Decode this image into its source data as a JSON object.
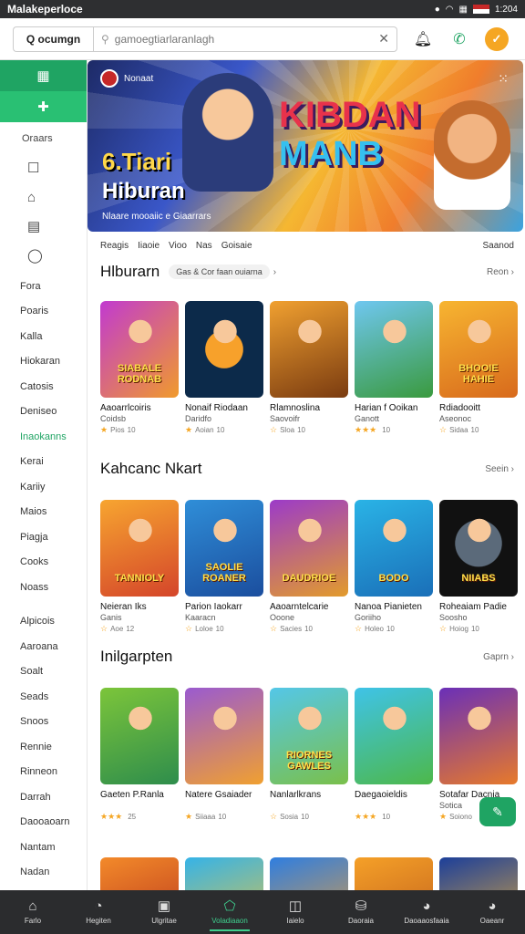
{
  "status_bar": {
    "title": "Malakeperloce",
    "time": "1:204"
  },
  "topbar": {
    "brand": "Q ocumgn",
    "search_placeholder": "gamoegtiarlaranlagh"
  },
  "sidebar": {
    "section_label": "Oraars",
    "items": [
      "Fora",
      "Poaris",
      "Kalla",
      "Hiokaran",
      "Catosis",
      "Deniseo",
      "Inaokanns",
      "Kerai",
      "Kariiy",
      "Maios",
      "Piagja",
      "Cooks",
      "Noass",
      "Alpicois",
      "Aaroana",
      "Soalt",
      "Seads",
      "Snoos",
      "Rennie",
      "Rinneon",
      "Darrah",
      "Daooaoarn",
      "Nantam",
      "Nadan"
    ],
    "active_index": 6
  },
  "hero": {
    "badge": "Nonaat",
    "line1": "6.Tiari",
    "line2": "Hiburan",
    "caption": "Nlaare mooaiic e Giaarrars",
    "logo_line1": "KIBDAN",
    "logo_line2": "MANB"
  },
  "filters": [
    "Reagis",
    "Iiaoie",
    "Vioo",
    "Nas",
    "Goisaie"
  ],
  "filters_right": "Saanod",
  "sections": [
    {
      "title": "Hlburarn",
      "chip": "Gas & Cor faan ouiarna",
      "more": "Reon",
      "cards": [
        {
          "name": "Aaoarrlcoiris",
          "sub": "Coidsb",
          "rating": "Pios",
          "count": "10",
          "stars": 1,
          "thumb_text": "SIABALE RODNAB",
          "bg": "linear-gradient(135deg,#c13ad0,#f09a2c)"
        },
        {
          "name": "Nonaif Riodaan",
          "sub": "Daridfo",
          "rating": "Aoian",
          "count": "10",
          "stars": 1,
          "thumb_text": "",
          "bg": "radial-gradient(circle at 50% 50%,#f7a12b 0 30%,#0c2a4a 31%)"
        },
        {
          "name": "Rlamnoslina",
          "sub": "Saovoifr",
          "rating": "Sloa",
          "count": "10",
          "stars": 0,
          "thumb_text": "",
          "bg": "linear-gradient(160deg,#f0a030,#7a3b10)"
        },
        {
          "name": "Harian f Ooikan",
          "sub": "Ganott",
          "rating": "",
          "count": "10",
          "stars": 3,
          "thumb_text": "",
          "bg": "linear-gradient(160deg,#6fc7f0,#3a9a3e)"
        },
        {
          "name": "Rdiadooitt",
          "sub": "Aseonoc",
          "rating": "Sidaa",
          "count": "10",
          "stars": 0,
          "thumb_text": "BHOOIE HAHIE",
          "bg": "linear-gradient(160deg,#f7b531,#d86a1c)"
        }
      ]
    },
    {
      "title": "Kahcanc Nkart",
      "chip": "",
      "more": "Seein",
      "cards": [
        {
          "name": "Neieran Iks",
          "sub": "Ganis",
          "rating": "Aoe",
          "count": "12",
          "stars": 0,
          "thumb_text": "TANNIOLY",
          "bg": "linear-gradient(160deg,#f7a530,#d4452a)"
        },
        {
          "name": "Parion Iaokarr",
          "sub": "Kaaracn",
          "rating": "Loloe",
          "count": "10",
          "stars": 0,
          "thumb_text": "SAOLIE ROANER",
          "bg": "linear-gradient(160deg,#2f8ed8,#1b4e9e)"
        },
        {
          "name": "Aaoarntelcarie",
          "sub": "Ooone",
          "rating": "Sacies",
          "count": "10",
          "stars": 0,
          "thumb_text": "DAUDRIOE",
          "bg": "linear-gradient(160deg,#9c3bc8,#e29b2c)"
        },
        {
          "name": "Nanoa Pianieten",
          "sub": "Goriiho",
          "rating": "Holeo",
          "count": "10",
          "stars": 0,
          "thumb_text": "BODO",
          "bg": "linear-gradient(160deg,#2ab3e6,#1a6fb8)"
        },
        {
          "name": "Roheaiam Padie",
          "sub": "Soosho",
          "rating": "Hoiog",
          "count": "10",
          "stars": 0,
          "thumb_text": "NIIABS",
          "bg": "radial-gradient(circle at 50% 45%,#5b6a7a 0 35%,#111 36%)"
        }
      ]
    },
    {
      "title": "Inilgarpten",
      "chip": "",
      "more": "Gaprn",
      "cards": [
        {
          "name": "Gaeten P.Ranla",
          "sub": "",
          "rating": "",
          "count": "25",
          "stars": 3,
          "thumb_text": "",
          "bg": "linear-gradient(160deg,#7cc53a,#2e8d4c)"
        },
        {
          "name": "Natere Gsaiader",
          "sub": "",
          "rating": "Siiaaa",
          "count": "10",
          "stars": 1,
          "thumb_text": "",
          "bg": "linear-gradient(160deg,#9a5ad0,#f0a030)"
        },
        {
          "name": "Nanlarlkrans",
          "sub": "",
          "rating": "Sosia",
          "count": "10",
          "stars": 0,
          "thumb_text": "RIORNES GAWLES",
          "bg": "linear-gradient(160deg,#54c7e8,#7ac04a)"
        },
        {
          "name": "Daegaoieldis",
          "sub": "",
          "rating": "",
          "count": "10",
          "stars": 3,
          "thumb_text": "",
          "bg": "linear-gradient(160deg,#3fc3e8,#4db84a)"
        },
        {
          "name": "Sotafar Dacnia",
          "sub": "Sotica",
          "rating": "Soiono",
          "count": "",
          "stars": 1,
          "thumb_text": "",
          "bg": "linear-gradient(160deg,#6a2fb8,#e77a2a)"
        }
      ]
    }
  ],
  "partial_row_bgs": [
    "linear-gradient(160deg,#f38a2a,#b02a1a)",
    "linear-gradient(160deg,#35b3e8,#f5c531)",
    "linear-gradient(160deg,#2f7ee0,#f7a12b)",
    "linear-gradient(160deg,#f5a028,#b8561a)",
    "linear-gradient(160deg,#1c3f9a,#f5b531)"
  ],
  "bottom_nav": [
    {
      "label": "Farlo",
      "icon": "⌂"
    },
    {
      "label": "Hegiten",
      "icon": "◔"
    },
    {
      "label": "Ulgritae",
      "icon": "▣"
    },
    {
      "label": "Voladiaaon",
      "icon": "⬠"
    },
    {
      "label": "Iaielo",
      "icon": "◫"
    },
    {
      "label": "Daoraia",
      "icon": "⛁"
    },
    {
      "label": "Daoaaosfaaia",
      "icon": "◕"
    },
    {
      "label": "Oaeanr",
      "icon": "◕"
    }
  ],
  "bottom_nav_active": 3
}
